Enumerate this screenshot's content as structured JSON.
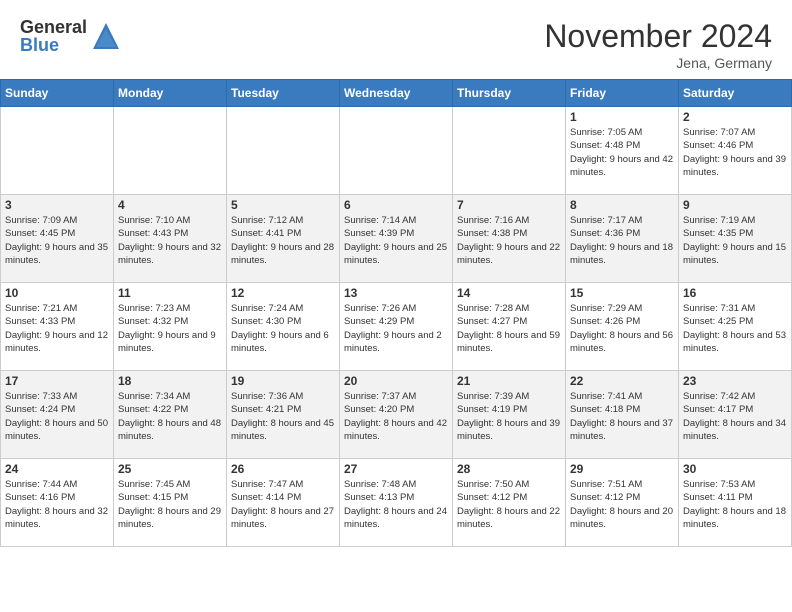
{
  "header": {
    "logo_general": "General",
    "logo_blue": "Blue",
    "month_title": "November 2024",
    "location": "Jena, Germany"
  },
  "calendar": {
    "days_of_week": [
      "Sunday",
      "Monday",
      "Tuesday",
      "Wednesday",
      "Thursday",
      "Friday",
      "Saturday"
    ],
    "weeks": [
      [
        {
          "day": "",
          "info": ""
        },
        {
          "day": "",
          "info": ""
        },
        {
          "day": "",
          "info": ""
        },
        {
          "day": "",
          "info": ""
        },
        {
          "day": "",
          "info": ""
        },
        {
          "day": "1",
          "info": "Sunrise: 7:05 AM\nSunset: 4:48 PM\nDaylight: 9 hours\nand 42 minutes."
        },
        {
          "day": "2",
          "info": "Sunrise: 7:07 AM\nSunset: 4:46 PM\nDaylight: 9 hours\nand 39 minutes."
        }
      ],
      [
        {
          "day": "3",
          "info": "Sunrise: 7:09 AM\nSunset: 4:45 PM\nDaylight: 9 hours\nand 35 minutes."
        },
        {
          "day": "4",
          "info": "Sunrise: 7:10 AM\nSunset: 4:43 PM\nDaylight: 9 hours\nand 32 minutes."
        },
        {
          "day": "5",
          "info": "Sunrise: 7:12 AM\nSunset: 4:41 PM\nDaylight: 9 hours\nand 28 minutes."
        },
        {
          "day": "6",
          "info": "Sunrise: 7:14 AM\nSunset: 4:39 PM\nDaylight: 9 hours\nand 25 minutes."
        },
        {
          "day": "7",
          "info": "Sunrise: 7:16 AM\nSunset: 4:38 PM\nDaylight: 9 hours\nand 22 minutes."
        },
        {
          "day": "8",
          "info": "Sunrise: 7:17 AM\nSunset: 4:36 PM\nDaylight: 9 hours\nand 18 minutes."
        },
        {
          "day": "9",
          "info": "Sunrise: 7:19 AM\nSunset: 4:35 PM\nDaylight: 9 hours\nand 15 minutes."
        }
      ],
      [
        {
          "day": "10",
          "info": "Sunrise: 7:21 AM\nSunset: 4:33 PM\nDaylight: 9 hours\nand 12 minutes."
        },
        {
          "day": "11",
          "info": "Sunrise: 7:23 AM\nSunset: 4:32 PM\nDaylight: 9 hours\nand 9 minutes."
        },
        {
          "day": "12",
          "info": "Sunrise: 7:24 AM\nSunset: 4:30 PM\nDaylight: 9 hours\nand 6 minutes."
        },
        {
          "day": "13",
          "info": "Sunrise: 7:26 AM\nSunset: 4:29 PM\nDaylight: 9 hours\nand 2 minutes."
        },
        {
          "day": "14",
          "info": "Sunrise: 7:28 AM\nSunset: 4:27 PM\nDaylight: 8 hours\nand 59 minutes."
        },
        {
          "day": "15",
          "info": "Sunrise: 7:29 AM\nSunset: 4:26 PM\nDaylight: 8 hours\nand 56 minutes."
        },
        {
          "day": "16",
          "info": "Sunrise: 7:31 AM\nSunset: 4:25 PM\nDaylight: 8 hours\nand 53 minutes."
        }
      ],
      [
        {
          "day": "17",
          "info": "Sunrise: 7:33 AM\nSunset: 4:24 PM\nDaylight: 8 hours\nand 50 minutes."
        },
        {
          "day": "18",
          "info": "Sunrise: 7:34 AM\nSunset: 4:22 PM\nDaylight: 8 hours\nand 48 minutes."
        },
        {
          "day": "19",
          "info": "Sunrise: 7:36 AM\nSunset: 4:21 PM\nDaylight: 8 hours\nand 45 minutes."
        },
        {
          "day": "20",
          "info": "Sunrise: 7:37 AM\nSunset: 4:20 PM\nDaylight: 8 hours\nand 42 minutes."
        },
        {
          "day": "21",
          "info": "Sunrise: 7:39 AM\nSunset: 4:19 PM\nDaylight: 8 hours\nand 39 minutes."
        },
        {
          "day": "22",
          "info": "Sunrise: 7:41 AM\nSunset: 4:18 PM\nDaylight: 8 hours\nand 37 minutes."
        },
        {
          "day": "23",
          "info": "Sunrise: 7:42 AM\nSunset: 4:17 PM\nDaylight: 8 hours\nand 34 minutes."
        }
      ],
      [
        {
          "day": "24",
          "info": "Sunrise: 7:44 AM\nSunset: 4:16 PM\nDaylight: 8 hours\nand 32 minutes."
        },
        {
          "day": "25",
          "info": "Sunrise: 7:45 AM\nSunset: 4:15 PM\nDaylight: 8 hours\nand 29 minutes."
        },
        {
          "day": "26",
          "info": "Sunrise: 7:47 AM\nSunset: 4:14 PM\nDaylight: 8 hours\nand 27 minutes."
        },
        {
          "day": "27",
          "info": "Sunrise: 7:48 AM\nSunset: 4:13 PM\nDaylight: 8 hours\nand 24 minutes."
        },
        {
          "day": "28",
          "info": "Sunrise: 7:50 AM\nSunset: 4:12 PM\nDaylight: 8 hours\nand 22 minutes."
        },
        {
          "day": "29",
          "info": "Sunrise: 7:51 AM\nSunset: 4:12 PM\nDaylight: 8 hours\nand 20 minutes."
        },
        {
          "day": "30",
          "info": "Sunrise: 7:53 AM\nSunset: 4:11 PM\nDaylight: 8 hours\nand 18 minutes."
        }
      ]
    ]
  }
}
